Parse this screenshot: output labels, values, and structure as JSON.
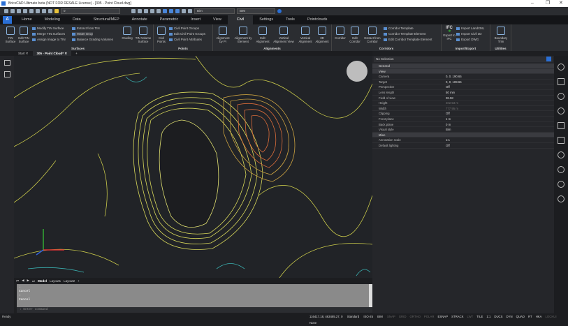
{
  "title": "BricsCAD Ultimate beta (NOT FOR RESALE License) - [305 - Point Cloud.dwg]",
  "qat": {
    "layer_value": "0",
    "visual_style": "Bim",
    "workspace": "BIM"
  },
  "tabs": [
    "Home",
    "Modeling",
    "Data",
    "Structural/MEP",
    "Annotate",
    "Parametric",
    "Insert",
    "View",
    "Civil",
    "Settings",
    "Tools",
    "Pointclouds"
  ],
  "active_tab": "Civil",
  "ribbon": {
    "surfaces": {
      "label": "Surfaces",
      "tin_surface": "TIN Surface",
      "edit_tin": "Edit TIN Surface",
      "modify": "Modify TIN Surface",
      "merge": "Merge TIN Surfaces",
      "assign": "Assign Image to TIN",
      "extract": "Extract from TIN",
      "water": "Water Drop",
      "balance": "Balance Grading Volumes",
      "grading": "Grading",
      "tin_volume": "TIN Volume Surface"
    },
    "points": {
      "label": "Points",
      "civil_points": "Civil Points",
      "groups": "Civil Point Groups",
      "edit_groups": "Edit Civil Point Groups",
      "attrs": "Civil Point Attributes"
    },
    "alignments": {
      "label": "Alignments",
      "by_pi": "Alignment by PI",
      "by_element": "Alignment by Element",
      "edit": "Edit Alignment",
      "vview": "Vertical Alignment View",
      "valign": "Vertical Alignment",
      "a3d": "3D Alignment"
    },
    "corridors": {
      "label": "Corridors",
      "corridor": "Corridor",
      "edit": "Edit Corridor",
      "extract": "Extract from Corridor",
      "template": "Corridor Template",
      "template_el": "Corridor Template Element",
      "edit_template_el": "Edit Corridor Template Element"
    },
    "importexport": {
      "label": "Import/Export",
      "ifc": "IFC",
      "export_ifc": "Export to IFC",
      "landxml": "Import LandXML",
      "civil3d": "Import Civil 3D",
      "dwg": "Export DWG"
    },
    "utilities": {
      "label": "Utilities",
      "boundary": "Boundary Trim"
    }
  },
  "doc_tabs": [
    "Start",
    "305 - Point Cloud*"
  ],
  "layout_tabs": [
    "Model",
    "Layout1",
    "Layout2",
    "+"
  ],
  "command_history": [
    ":",
    "Cancel",
    ":",
    "Cancel"
  ],
  "command_prompt": ": Enter command",
  "properties": {
    "selection": "No Selection",
    "rows": [
      {
        "k": "General",
        "v": "",
        "type": "cat"
      },
      {
        "k": "View",
        "v": "",
        "type": "cat"
      },
      {
        "k": "Camera",
        "v": "0, 0, 190.65"
      },
      {
        "k": "Target",
        "v": "0, 0, 189.65"
      },
      {
        "k": "Perspective",
        "v": "Off"
      },
      {
        "k": "Lens length",
        "v": "50 mm"
      },
      {
        "k": "Field of view",
        "v": "38.58"
      },
      {
        "k": "Height",
        "v": "402.53 m",
        "type": "dim"
      },
      {
        "k": "Width",
        "v": "777.95 m",
        "type": "dim"
      },
      {
        "k": "Clipping",
        "v": "Off"
      },
      {
        "k": "Front plane",
        "v": "1 m"
      },
      {
        "k": "Back plane",
        "v": "0 m"
      },
      {
        "k": "Visual style",
        "v": "Bim"
      },
      {
        "k": "Misc",
        "v": "",
        "type": "cat"
      },
      {
        "k": "Annotation scale",
        "v": "1:1"
      },
      {
        "k": "Default lighting",
        "v": "Off"
      }
    ]
  },
  "status": {
    "ready": "Ready",
    "coords": "116417.18, 463485.27, 0",
    "style": "Standard",
    "dim": "ISO-25",
    "ws": "BIM",
    "toggles": [
      {
        "t": "SNAP",
        "on": false
      },
      {
        "t": "GRID",
        "on": false
      },
      {
        "t": "ORTHO",
        "on": false
      },
      {
        "t": "POLAR",
        "on": false
      },
      {
        "t": "ESNAP",
        "on": true
      },
      {
        "t": "STRACK",
        "on": true
      },
      {
        "t": "LWT",
        "on": false
      },
      {
        "t": "TILE",
        "on": true
      },
      {
        "t": "1:1",
        "on": true
      },
      {
        "t": "DUCS",
        "on": true
      },
      {
        "t": "DYN",
        "on": true
      },
      {
        "t": "QUAD",
        "on": true
      },
      {
        "t": "RT",
        "on": true
      },
      {
        "t": "HKA",
        "on": true
      },
      {
        "t": "LOCKUI",
        "on": false
      },
      {
        "t": "None",
        "on": true
      }
    ]
  }
}
